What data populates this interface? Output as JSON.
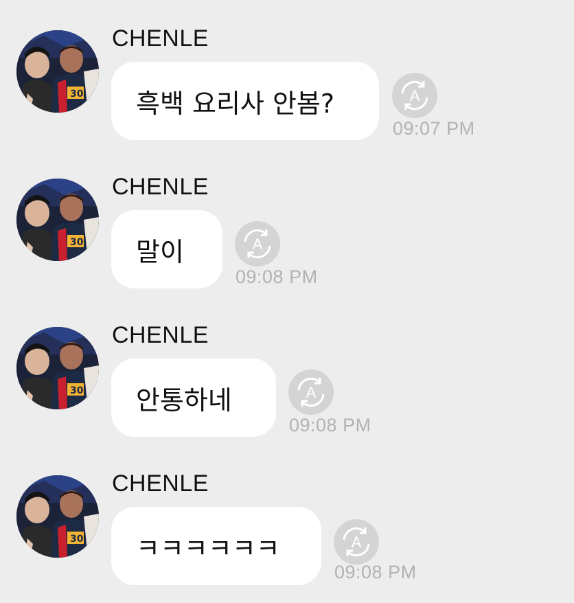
{
  "messages": [
    {
      "sender": "CHENLE",
      "text": "흑백 요리사 안봄?",
      "time": "09:07 PM"
    },
    {
      "sender": "CHENLE",
      "text": "말이",
      "time": "09:08 PM"
    },
    {
      "sender": "CHENLE",
      "text": "안통하네",
      "time": "09:08 PM"
    },
    {
      "sender": "CHENLE",
      "text": "ㅋㅋㅋㅋㅋㅋ",
      "time": "09:08 PM"
    }
  ],
  "translate_icon_label": "A",
  "colors": {
    "background": "#ededed",
    "bubble": "#ffffff",
    "timestamp": "#b2b2b2",
    "translate_button": "#d4d4d4"
  }
}
